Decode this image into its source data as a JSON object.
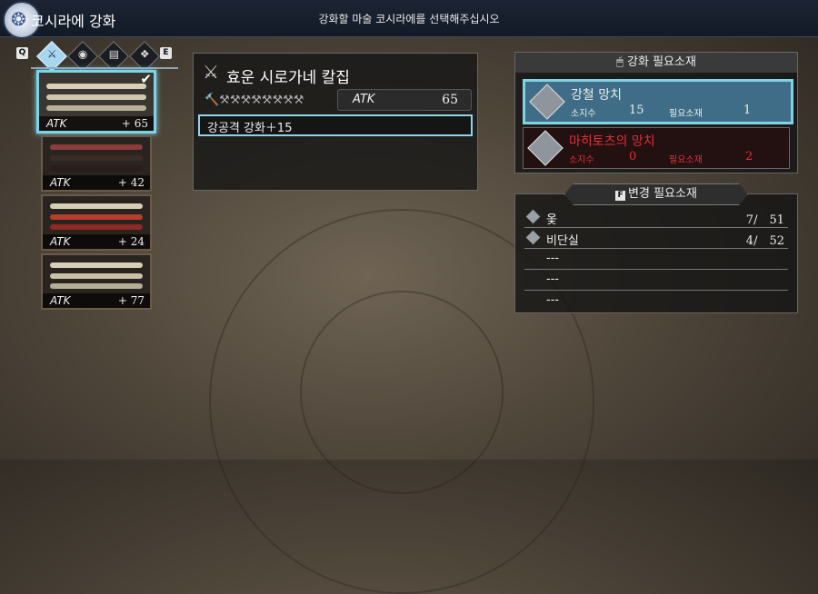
{
  "header": {
    "title": "코시라에 강화",
    "instruction": "강화할 마술 코시라에를 선택해주십시오"
  },
  "category_bar": {
    "left_key": "Q",
    "right_key": "E",
    "categories": [
      {
        "icon": "sword-icon",
        "active": true
      },
      {
        "icon": "guard-icon",
        "active": false
      },
      {
        "icon": "grip-icon",
        "active": false
      },
      {
        "icon": "ornament-icon",
        "active": false
      }
    ]
  },
  "items": [
    {
      "stat_label": "ATK",
      "stat_value": "+ 65",
      "selected": true,
      "colors": [
        "#d8d0b8",
        "#cfc6ad",
        "#b9b09a"
      ]
    },
    {
      "stat_label": "ATK",
      "stat_value": "+ 42",
      "selected": false,
      "colors": [
        "#8a3d3a",
        "#3b2b27",
        "#2a1d1b"
      ]
    },
    {
      "stat_label": "ATK",
      "stat_value": "+ 24",
      "selected": false,
      "colors": [
        "#d7cfb5",
        "#b73d2e",
        "#8e2a22"
      ]
    },
    {
      "stat_label": "ATK",
      "stat_value": "+ 77",
      "selected": false,
      "colors": [
        "#d6cfb8",
        "#c9c1a8",
        "#b6ad96"
      ]
    }
  ],
  "detail": {
    "name": "효운 시로가네 칼집",
    "stat_label": "ATK",
    "stat_value": "65",
    "hammers": "🔨⚒⚒⚒⚒⚒⚒⚒⚒",
    "effect": "강공격 강화＋15"
  },
  "required_materials": {
    "header": "강화 필요소재",
    "items": [
      {
        "name": "강철 망치",
        "owned_label": "소지수",
        "owned": "15",
        "need_label": "필요소재",
        "need": "1",
        "state": "sel"
      },
      {
        "name": "마히토츠의 망치",
        "owned_label": "소지수",
        "owned": "0",
        "need_label": "필요소재",
        "need": "2",
        "state": "unav"
      }
    ]
  },
  "change_materials": {
    "key": "F",
    "header": "변경 필요소재",
    "rows": [
      {
        "name": "옻",
        "count": "7/　51"
      },
      {
        "name": "비단실",
        "count": "4/　52"
      },
      {
        "name": "---",
        "count": ""
      },
      {
        "name": "---",
        "count": ""
      },
      {
        "name": "---",
        "count": ""
      }
    ]
  }
}
